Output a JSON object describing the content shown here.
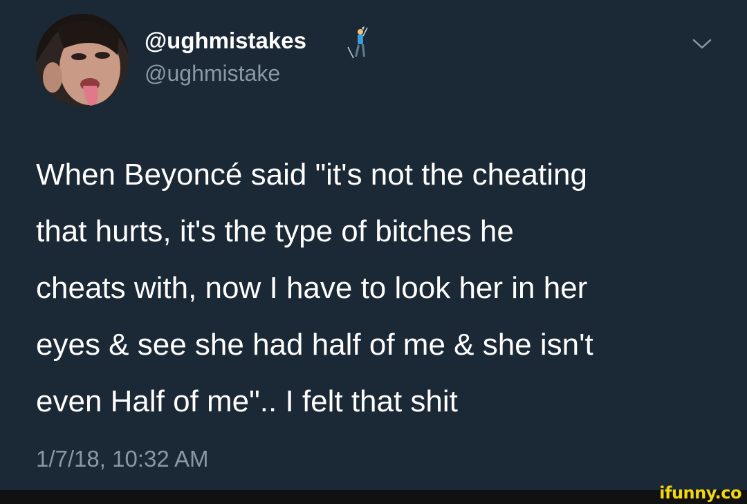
{
  "author": {
    "display_name": "@ughmistakes",
    "handle": "@ughmistake",
    "name_emoji": "golfer-emoji",
    "avatar": "profile-photo"
  },
  "tweet": {
    "text": "When Beyoncé said \"it's not the cheating\nthat hurts, it's the type of bitches he\ncheats with, now I have to look her in her\neyes & see she had half of me & she isn't\neven Half of me\".. I felt that shit",
    "timestamp": "1/7/18, 10:32 AM"
  },
  "icons": {
    "menu": "chevron-down-icon"
  },
  "watermark": {
    "text": "ifunny.co"
  },
  "colors": {
    "background": "#1b2836",
    "primary_text": "#ffffff",
    "secondary_text": "#8899a6",
    "watermark": "#f2d70f"
  }
}
